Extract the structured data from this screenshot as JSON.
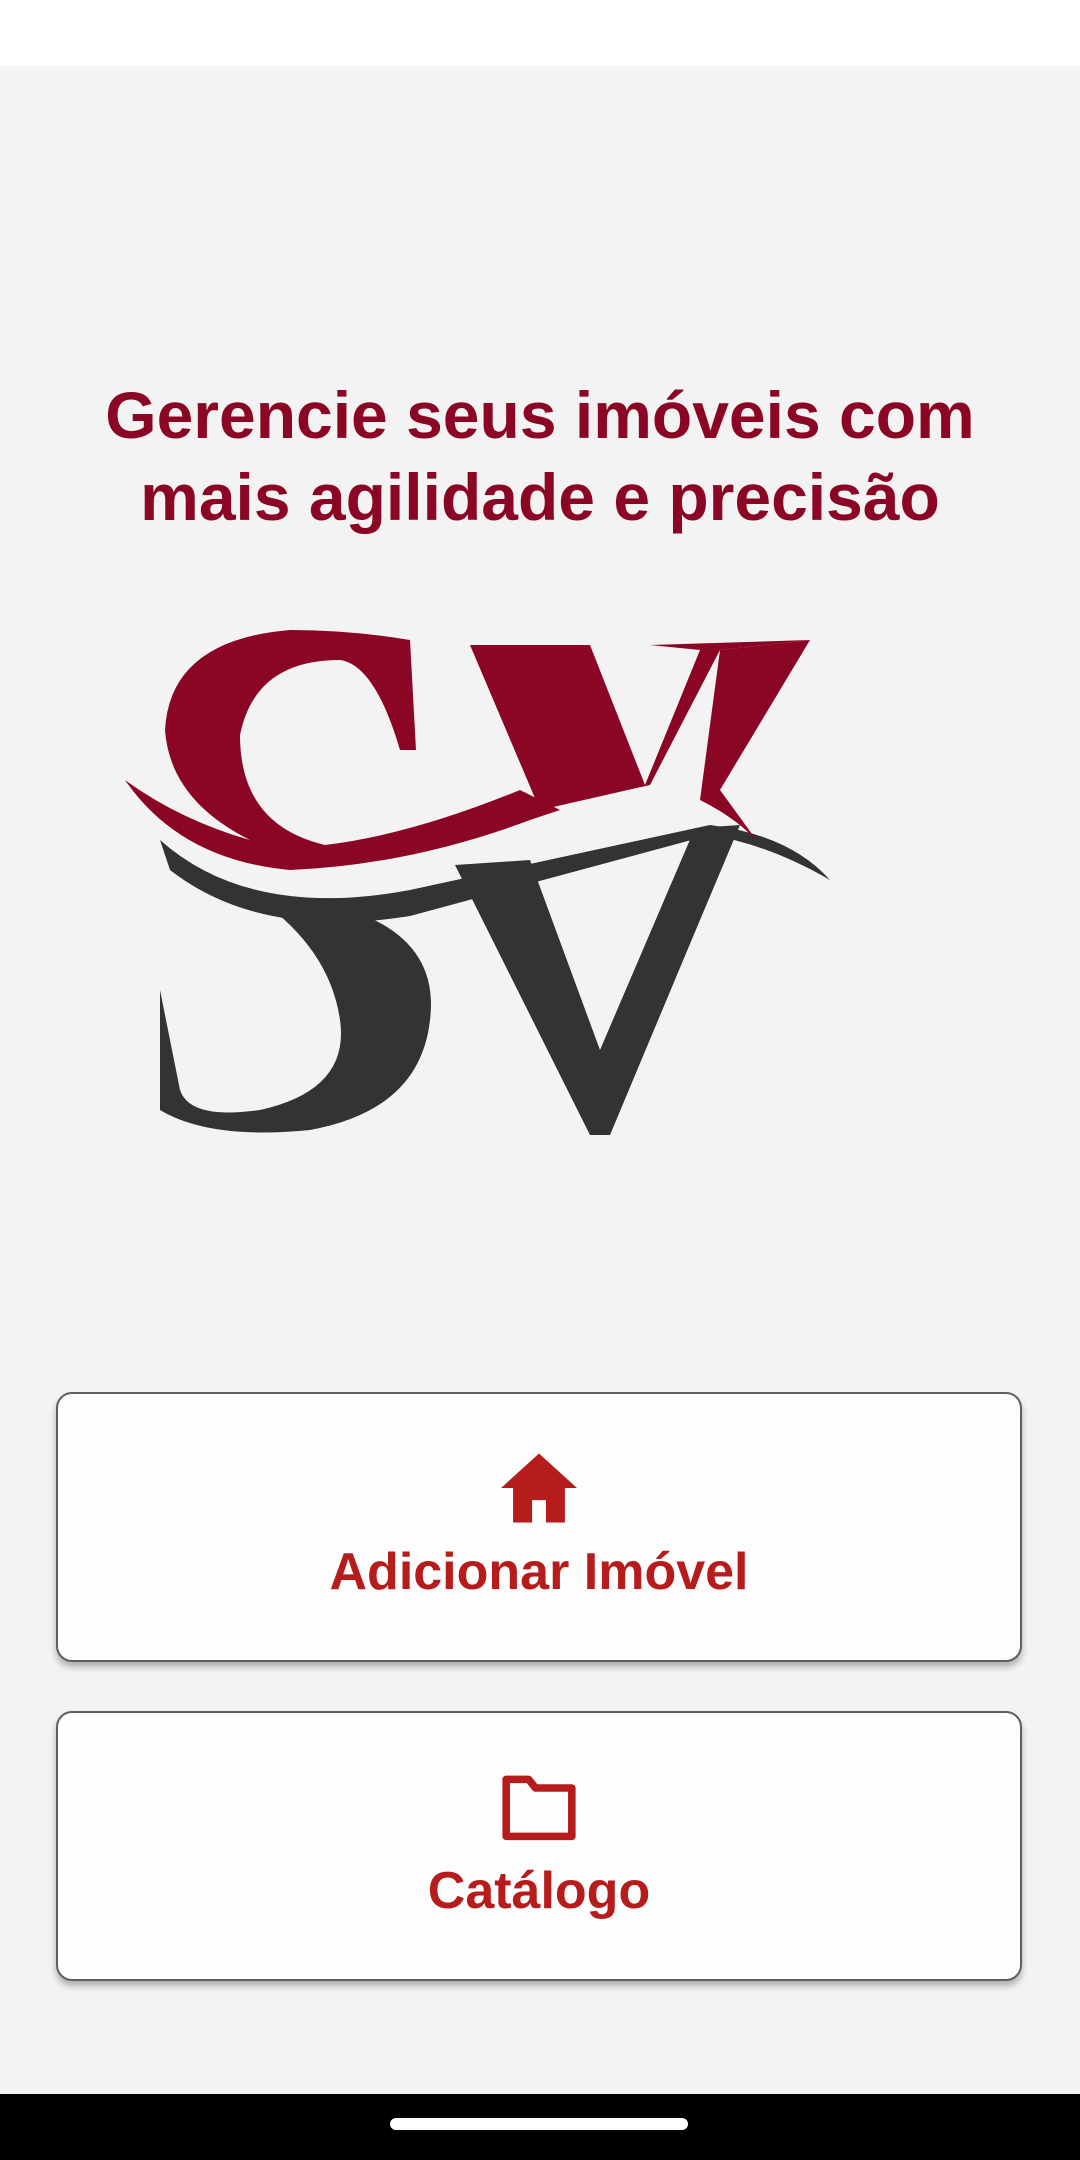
{
  "headline": {
    "line1": "Gerencie seus imóveis com",
    "line2": "mais agilidade e precisão"
  },
  "logo": {
    "text": "SV",
    "primary_color": "#8b0624",
    "secondary_color": "#333333"
  },
  "actions": [
    {
      "label": "Adicionar Imóvel",
      "icon": "home-icon"
    },
    {
      "label": "Catálogo",
      "icon": "folder-icon"
    }
  ],
  "colors": {
    "accent": "#b71c1c",
    "headline": "#8b0624",
    "background": "#f3f3f3"
  }
}
